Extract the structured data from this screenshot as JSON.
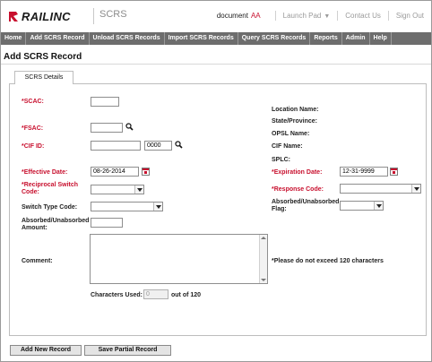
{
  "header": {
    "logo_text": "RAILINC",
    "app_name": "SCRS",
    "user_label": "document",
    "user_id": "AA",
    "launch_pad": "Launch Pad",
    "contact_us": "Contact Us",
    "sign_out": "Sign Out"
  },
  "menu": [
    "Home",
    "Add SCRS Record",
    "Unload SCRS Records",
    "Import SCRS Records",
    "Query SCRS Records",
    "Reports",
    "Admin",
    "Help"
  ],
  "page_title": "Add SCRS Record",
  "tab_label": "SCRS Details",
  "form": {
    "scac_label": "*SCAC:",
    "fsac_label": "*FSAC:",
    "cif_id_label": "*CIF ID:",
    "cif_id_suffix": "0000",
    "effective_date_label": "*Effective Date:",
    "effective_date_value": "08-26-2014",
    "reciprocal_label": "*Reciprocal Switch Code:",
    "switch_type_label": "Switch Type Code:",
    "absorbed_amount_label": "Absorbed/Unabsorbed Amount:",
    "comment_label": "Comment:",
    "chars_used_label": "Characters Used:",
    "chars_used_value": "0",
    "chars_max": "out of 120",
    "comment_note": "*Please do not exceed 120 characters",
    "location_name_label": "Location Name:",
    "state_label": "State/Province:",
    "opsl_label": "OPSL Name:",
    "cif_name_label": "CIF Name:",
    "splc_label": "SPLC:",
    "expiration_label": "*Expiration Date:",
    "expiration_value": "12-31-9999",
    "response_label": "*Response Code:",
    "absorbed_flag_label": "Absorbed/Unabsorbed Flag:"
  },
  "buttons": {
    "add_new": "Add New Record",
    "save_partial": "Save Partial Record"
  },
  "colors": {
    "required": "#c8102e",
    "menubar": "#6d6d6d",
    "button": "#e4e4e4"
  }
}
